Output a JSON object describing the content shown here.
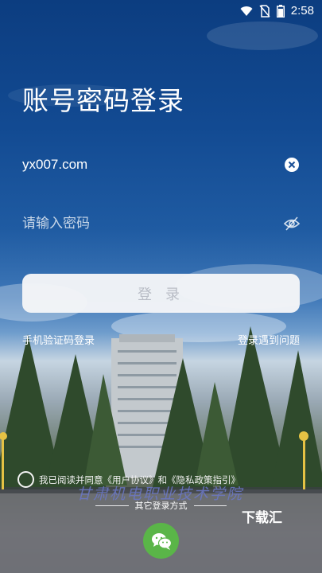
{
  "status_bar": {
    "time": "2:58",
    "icons": [
      "wifi-icon",
      "no-sim-icon",
      "battery-icon"
    ]
  },
  "login": {
    "title": "账号密码登录",
    "account_value": "yx007.com",
    "password_placeholder": "请输入密码",
    "login_button": "登 录",
    "sms_login_link": "手机验证码登录",
    "problem_link": "登录遇到问题"
  },
  "agreement": {
    "prefix": "我已阅读并同意",
    "user_agreement": "《用户协议》",
    "conjunction": "和",
    "privacy_policy": "《隐私政策指引》"
  },
  "other_login": {
    "label": "其它登录方式",
    "options": [
      "wechat-icon"
    ]
  },
  "background": {
    "school_name": "甘肃机电职业技术学院"
  },
  "watermark": "下载汇",
  "colors": {
    "sky": "#0c3d80",
    "button_bg": "#f5f6f8",
    "button_text": "#b9bdc6",
    "wechat": "#5ab548"
  }
}
